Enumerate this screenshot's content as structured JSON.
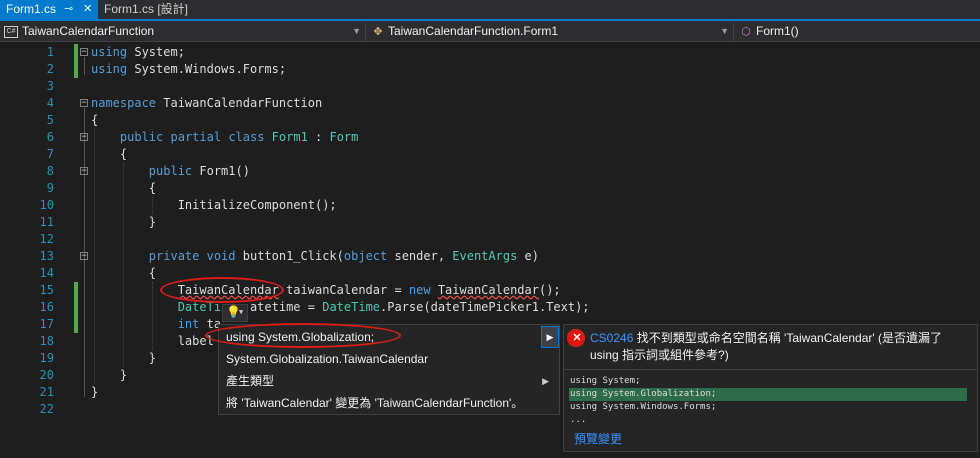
{
  "tabs": [
    {
      "label": "Form1.cs",
      "pin_icon": "⊸",
      "close_icon": "✕"
    },
    {
      "label": "Form1.cs [設計]"
    }
  ],
  "navbar": {
    "project": {
      "icon": "C#",
      "label": "TaiwanCalendarFunction"
    },
    "type": {
      "icon": "✥",
      "label": "TaiwanCalendarFunction.Form1"
    },
    "member": {
      "icon": "⬡",
      "label": "Form1()"
    }
  },
  "editor": {
    "line_numbers": [
      "1",
      "2",
      "3",
      "4",
      "5",
      "6",
      "7",
      "8",
      "9",
      "10",
      "11",
      "12",
      "13",
      "14",
      "15",
      "16",
      "17",
      "18",
      "19",
      "20",
      "21",
      "22"
    ]
  },
  "quick_actions": {
    "items": [
      "using System.Globalization;",
      "System.Globalization.TaiwanCalendar",
      "產生類型",
      "將 'TaiwanCalendar' 變更為 'TaiwanCalendarFunction'。"
    ]
  },
  "preview": {
    "error_code": "CS0246",
    "error_message": " 找不到類型或命名空間名稱 'TaiwanCalendar' (是否遺漏了 using 指示詞或組件參考?)",
    "code_lines": [
      "using System;",
      "using System.Globalization;",
      "using System.Windows.Forms;",
      "..."
    ],
    "preview_link": "預覽變更"
  },
  "colors": {
    "accent": "#007acc",
    "keyword": "#569cd6",
    "type": "#4ec9b0",
    "line_number": "#2b91af",
    "error": "#e51400",
    "annotation": "#d91c1c"
  }
}
